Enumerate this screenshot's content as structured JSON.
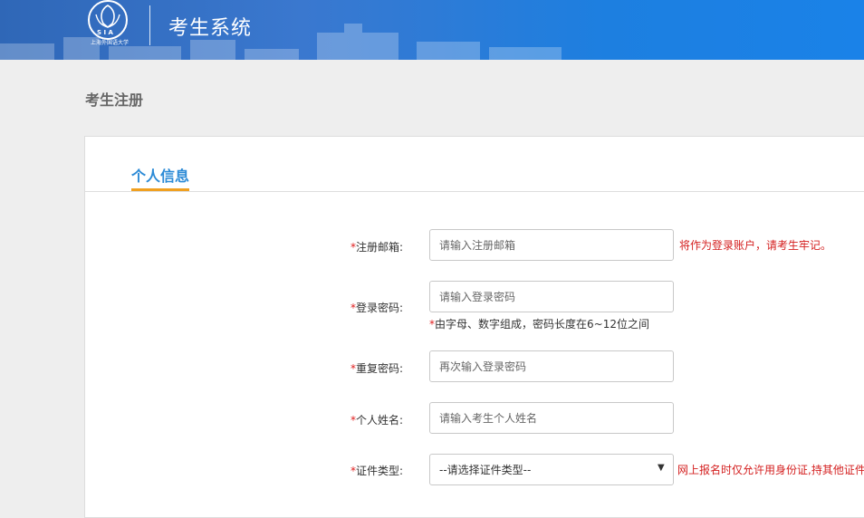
{
  "header": {
    "title": "考生系统",
    "logo_text": "上海外国语大学"
  },
  "page": {
    "title": "考生注册"
  },
  "tabs": [
    {
      "label": "个人信息"
    }
  ],
  "form": {
    "required_mark": "*",
    "email": {
      "label": "注册邮箱:",
      "placeholder": "请输入注册邮箱",
      "hint": "将作为登录账户，请考生牢记。"
    },
    "password": {
      "label": "登录密码:",
      "placeholder": "请输入登录密码",
      "hint": "由字母、数字组成，密码长度在6~12位之间"
    },
    "confirm_password": {
      "label": "重复密码:",
      "placeholder": "再次输入登录密码"
    },
    "name": {
      "label": "个人姓名:",
      "placeholder": "请输入考生个人姓名"
    },
    "id_type": {
      "label": "证件类型:",
      "selected": "--请选择证件类型--",
      "hint": "网上报名时仅允许用身份证,持其他证件"
    }
  },
  "colors": {
    "header_blue": "#1a82e8",
    "tab_blue": "#2b8ad6",
    "tab_underline": "#f0a020",
    "hint_red": "#d42020"
  }
}
